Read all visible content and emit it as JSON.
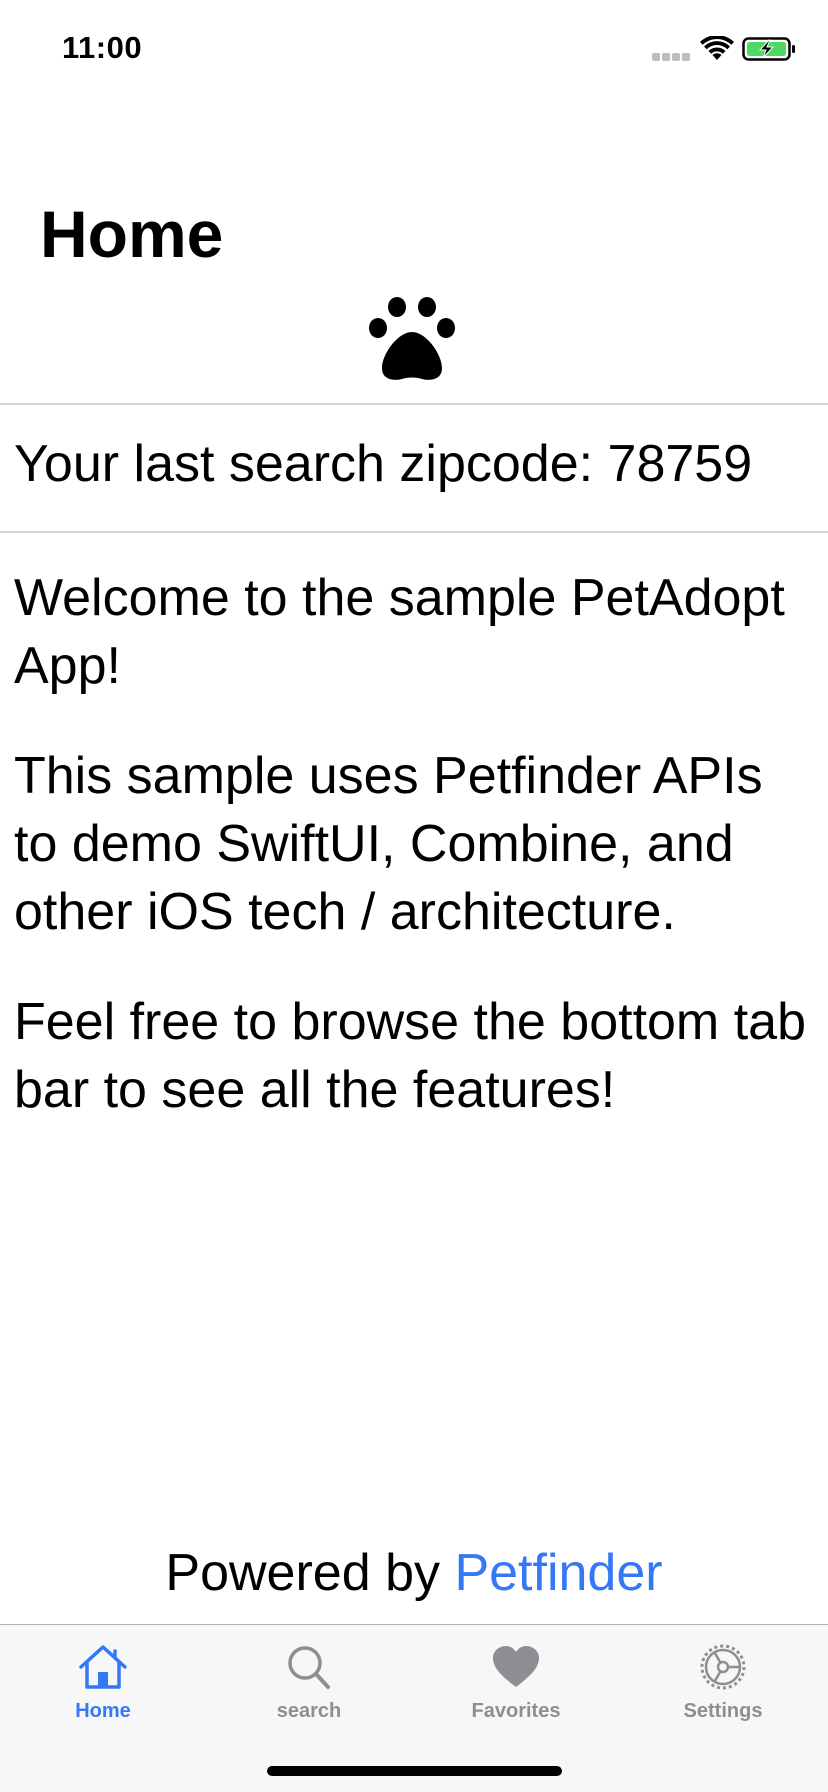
{
  "status_bar": {
    "time": "11:00",
    "icons": [
      "signal-dots-icon",
      "wifi-icon",
      "battery-charging-icon"
    ],
    "battery_color": "#4cd964"
  },
  "header": {
    "title": "Home",
    "logo_icon": "paw-icon"
  },
  "zipcode": {
    "text": "Your last search zipcode: 78759"
  },
  "body": {
    "paragraphs": [
      "Welcome to the sample PetAdopt App!",
      "This sample uses Petfinder APIs to demo SwiftUI, Combine, and other iOS tech / architecture.",
      "Feel free to browse the bottom tab bar to see all the features!"
    ]
  },
  "footer": {
    "powered_by_label": "Powered by",
    "link_label": "Petfinder",
    "link_color": "#3478f6"
  },
  "tab_bar": {
    "tabs": [
      {
        "label": "Home",
        "icon": "house-icon",
        "active": true
      },
      {
        "label": "search",
        "icon": "magnifying-glass-icon",
        "active": false
      },
      {
        "label": "Favorites",
        "icon": "heart-icon",
        "active": false
      },
      {
        "label": "Settings",
        "icon": "gear-icon",
        "active": false
      }
    ],
    "active_color": "#3478f6",
    "inactive_color": "#8e8e93"
  }
}
